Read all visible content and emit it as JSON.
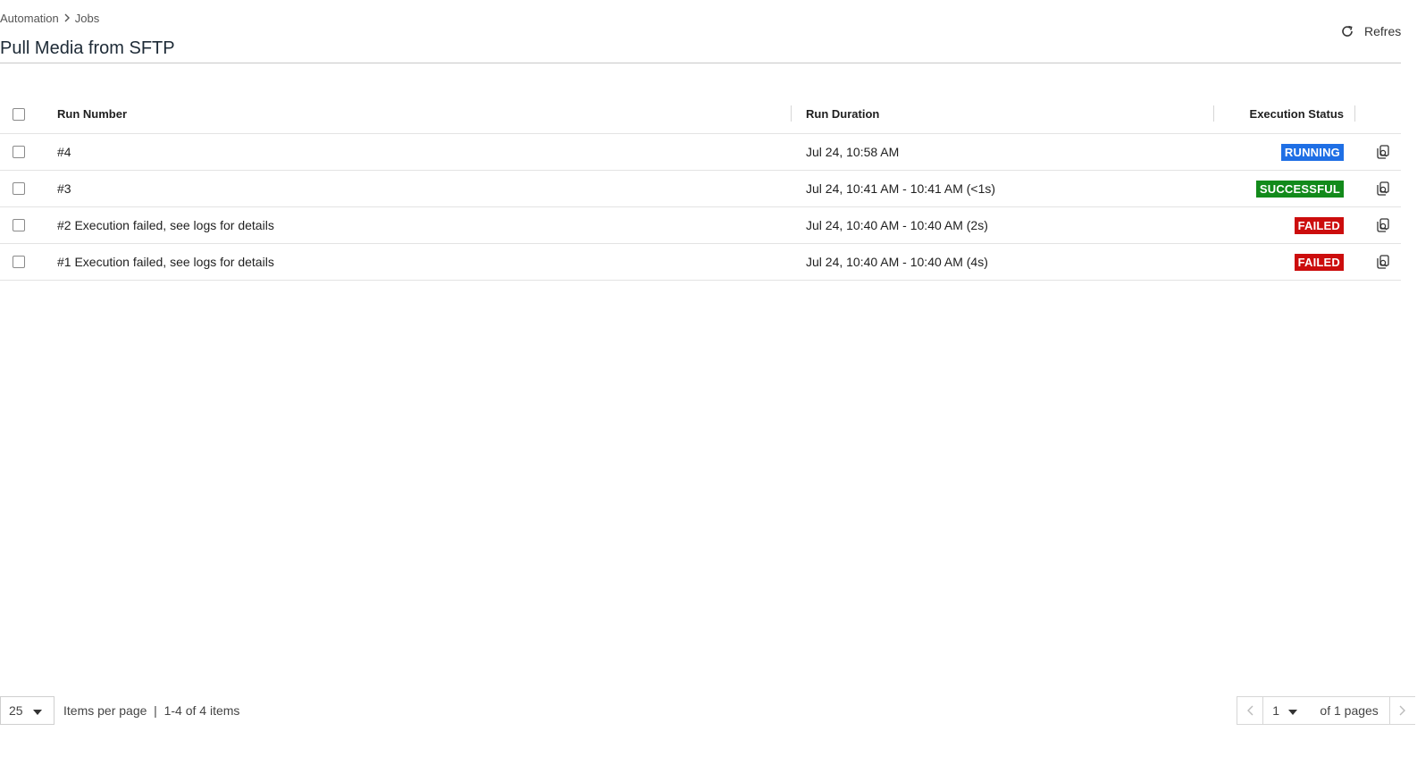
{
  "breadcrumb": {
    "items": [
      "Automation",
      "Jobs"
    ]
  },
  "page": {
    "title": "Pull Media from SFTP"
  },
  "toolbar": {
    "refresh_label": "Refres"
  },
  "table": {
    "columns": [
      "Run Number",
      "Run Duration",
      "Execution Status"
    ],
    "rows": [
      {
        "run": "#4",
        "duration": "Jul 24, 10:58 AM",
        "status": "RUNNING",
        "status_color": "#1f6fe5"
      },
      {
        "run": "#3",
        "duration": "Jul 24, 10:41 AM - 10:41 AM (<1s)",
        "status": "SUCCESSFUL",
        "status_color": "#128a1b"
      },
      {
        "run": "#2 Execution failed, see logs for details",
        "duration": "Jul 24, 10:40 AM - 10:40 AM (2s)",
        "status": "FAILED",
        "status_color": "#cc0d0d"
      },
      {
        "run": "#1 Execution failed, see logs for details",
        "duration": "Jul 24, 10:40 AM - 10:40 AM (4s)",
        "status": "FAILED",
        "status_color": "#cc0d0d"
      }
    ],
    "row_action_icon": "view-logs-icon"
  },
  "pagination": {
    "page_size": "25",
    "items_per_page_label": "Items per page",
    "range_label": "1-4 of 4 items",
    "current_page": "1",
    "total_pages_label": "of 1 pages"
  }
}
